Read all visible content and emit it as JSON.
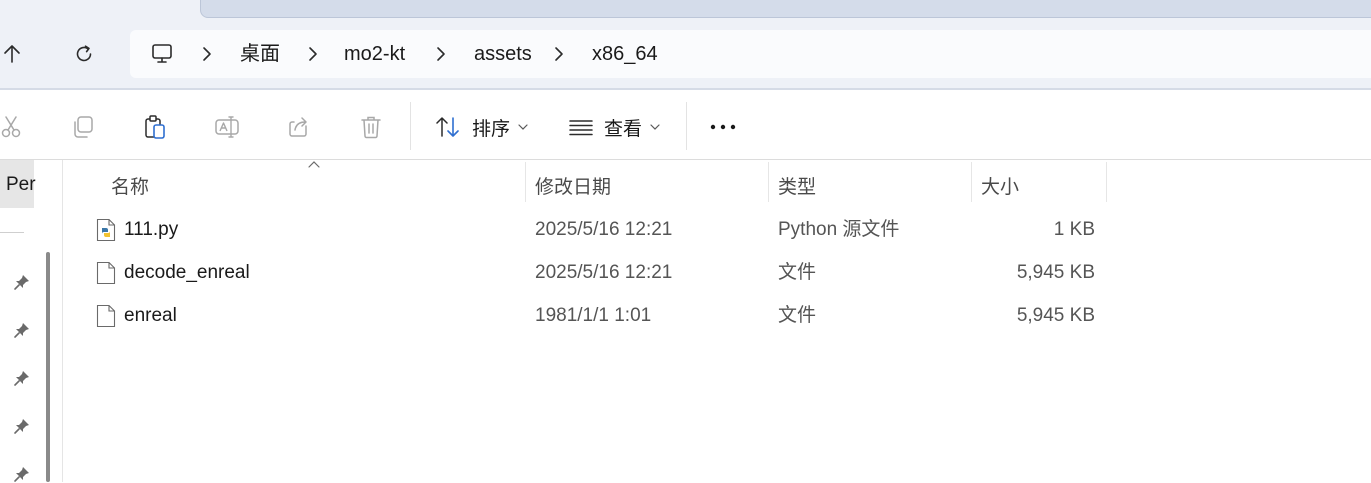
{
  "navigation": {
    "breadcrumbs": [
      "桌面",
      "mo2-kt",
      "assets",
      "x86_64"
    ]
  },
  "toolbar": {
    "sort_label": "排序",
    "view_label": "查看"
  },
  "left_pane": {
    "selected_item_partial": "Per"
  },
  "file_list": {
    "columns": {
      "name": "名称",
      "date_modified": "修改日期",
      "type": "类型",
      "size": "大小"
    },
    "rows": [
      {
        "name": "111.py",
        "date_modified": "2025/5/16 12:21",
        "type": "Python 源文件",
        "size": "1 KB",
        "icon": "python-file-icon"
      },
      {
        "name": "decode_enreal",
        "date_modified": "2025/5/16 12:21",
        "type": "文件",
        "size": "5,945 KB",
        "icon": "generic-file-icon"
      },
      {
        "name": "enreal",
        "date_modified": "1981/1/1 1:01",
        "type": "文件",
        "size": "5,945 KB",
        "icon": "generic-file-icon"
      }
    ]
  },
  "colors": {
    "nav_background": "#eef1f7",
    "address_background": "#fafbfd",
    "selected_item": "#e6e6e6",
    "python_icon_blue": "#3b77a8",
    "python_icon_yellow": "#f2c230"
  }
}
